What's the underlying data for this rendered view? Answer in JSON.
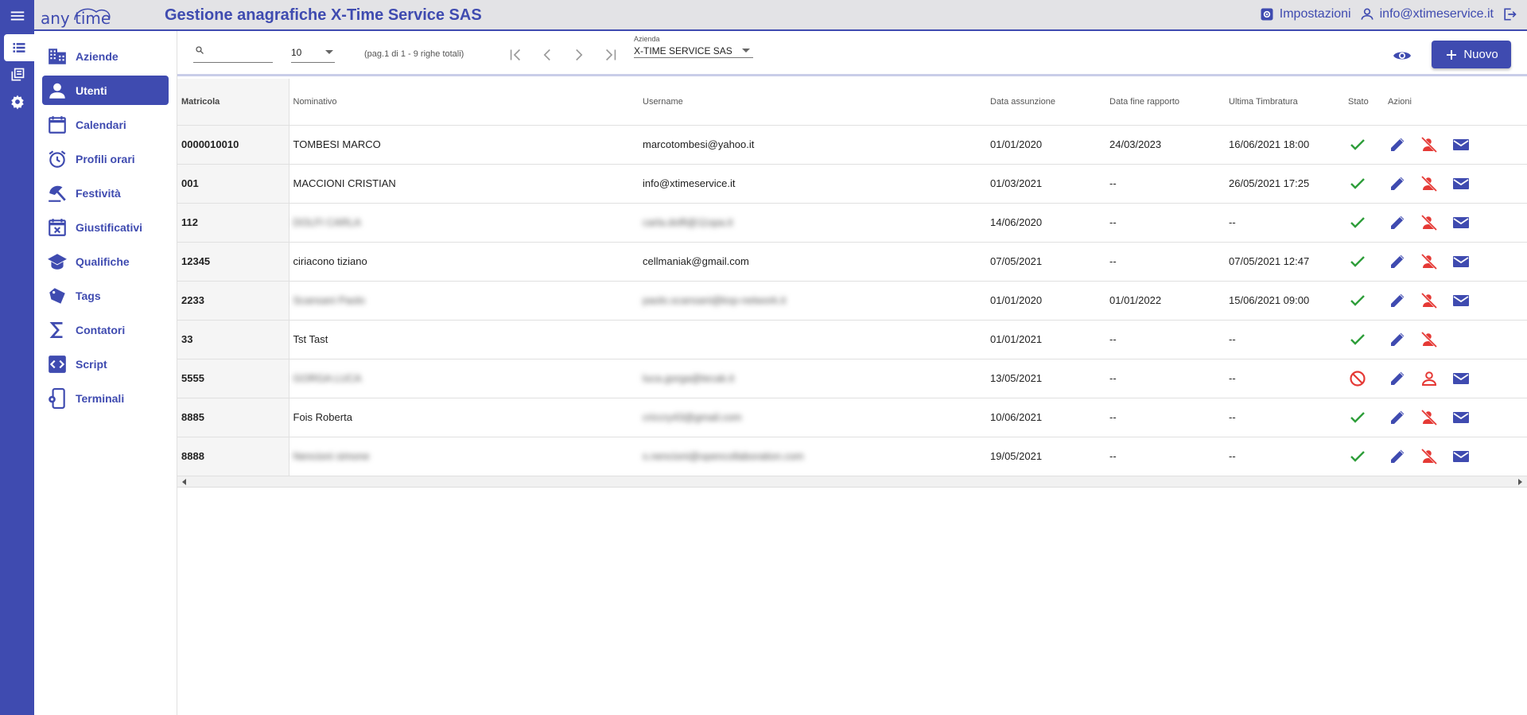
{
  "app": {
    "logo_text": "any time",
    "title": "Gestione anagrafiche X-Time Service SAS",
    "settings_label": "Impostazioni",
    "user_email": "info@xtimeservice.it",
    "accent_color": "#3f4bb0"
  },
  "sidebar": {
    "items": [
      {
        "label": "Aziende",
        "icon": "building-icon"
      },
      {
        "label": "Utenti",
        "icon": "person-icon",
        "active": true
      },
      {
        "label": "Calendari",
        "icon": "calendar-icon"
      },
      {
        "label": "Profili orari",
        "icon": "alarm-clock-icon"
      },
      {
        "label": "Festività",
        "icon": "beach-umbrella-icon"
      },
      {
        "label": "Giustificativi",
        "icon": "calendar-cross-icon"
      },
      {
        "label": "Qualifiche",
        "icon": "graduation-cap-icon"
      },
      {
        "label": "Tags",
        "icon": "tag-icon"
      },
      {
        "label": "Contatori",
        "icon": "sigma-icon"
      },
      {
        "label": "Script",
        "icon": "code-icon"
      },
      {
        "label": "Terminali",
        "icon": "terminal-device-icon"
      }
    ]
  },
  "toolbar": {
    "search_value": "",
    "page_size": "10",
    "page_info": "(pag.1 di 1 - 9 righe totali)",
    "azienda_label": "Azienda",
    "azienda_value": "X-TIME SERVICE SAS",
    "new_button": "Nuovo"
  },
  "table": {
    "columns": [
      "Matricola",
      "Nominativo",
      "Username",
      "Data assunzione",
      "Data fine rapporto",
      "Ultima Timbratura",
      "Stato",
      "Azioni"
    ],
    "rows": [
      {
        "matricola": "0000010010",
        "nominativo": "TOMBESI MARCO",
        "username": "marcotombesi@yahoo.it",
        "assunzione": "01/01/2020",
        "fine": "24/03/2023",
        "timbratura": "16/06/2021 18:00",
        "stato": "active",
        "blurred": false,
        "mail": true,
        "user_icon": "person-off-icon"
      },
      {
        "matricola": "001",
        "nominativo": "MACCIONI CRISTIAN",
        "username": "info@xtimeservice.it",
        "assunzione": "01/03/2021",
        "fine": "--",
        "timbratura": "26/05/2021 17:25",
        "stato": "active",
        "blurred": false,
        "mail": true,
        "user_icon": "person-off-icon"
      },
      {
        "matricola": "112",
        "nominativo": "DOLFI CARLA",
        "username": "carla.dolfi@11spa.it",
        "assunzione": "14/06/2020",
        "fine": "--",
        "timbratura": "--",
        "stato": "active",
        "blurred": true,
        "mail": true,
        "user_icon": "person-off-icon"
      },
      {
        "matricola": "12345",
        "nominativo": "ciriacono tiziano",
        "username": "cellmaniak@gmail.com",
        "assunzione": "07/05/2021",
        "fine": "--",
        "timbratura": "07/05/2021 12:47",
        "stato": "active",
        "blurred": false,
        "mail": true,
        "user_icon": "person-off-icon"
      },
      {
        "matricola": "2233",
        "nominativo": "Scansani Paolo",
        "username": "paolo.scansani@ksp-network.it",
        "assunzione": "01/01/2020",
        "fine": "01/01/2022",
        "timbratura": "15/06/2021 09:00",
        "stato": "active",
        "blurred": true,
        "mail": true,
        "user_icon": "person-off-icon"
      },
      {
        "matricola": "33",
        "nominativo": "Tst Tast",
        "username": "",
        "assunzione": "01/01/2021",
        "fine": "--",
        "timbratura": "--",
        "stato": "active",
        "blurred": false,
        "mail": false,
        "user_icon": "person-off-icon"
      },
      {
        "matricola": "5555",
        "nominativo": "GORGA LUCA",
        "username": "luca.gorga@tecak.it",
        "assunzione": "13/05/2021",
        "fine": "--",
        "timbratura": "--",
        "stato": "disabled",
        "blurred": true,
        "mail": true,
        "user_icon": "person-icon"
      },
      {
        "matricola": "8885",
        "nominativo": "Fois Roberta",
        "username": "criccry43@gmail.com",
        "assunzione": "10/06/2021",
        "fine": "--",
        "timbratura": "--",
        "stato": "active",
        "blurred_username_only": true,
        "blurred": false,
        "mail": true,
        "user_icon": "person-off-icon"
      },
      {
        "matricola": "8888",
        "nominativo": "Nencioni simone",
        "username": "s.nencioni@opencollaboration.com",
        "assunzione": "19/05/2021",
        "fine": "--",
        "timbratura": "--",
        "stato": "active",
        "blurred": true,
        "mail": true,
        "user_icon": "person-off-icon"
      }
    ]
  }
}
